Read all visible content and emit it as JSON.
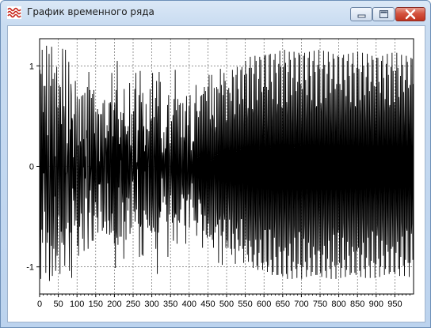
{
  "window": {
    "title": "График временного ряда",
    "icon": "wave-chart-icon",
    "controls": [
      "minimize-icon",
      "maximize-icon",
      "close-icon"
    ],
    "close_color": "#c7402c"
  },
  "chart_data": {
    "type": "line",
    "title": "",
    "xlabel": "",
    "ylabel": "",
    "xlim": [
      0,
      1000
    ],
    "ylim": [
      -1.27,
      1.27
    ],
    "x_ticks": [
      0,
      50,
      100,
      150,
      200,
      250,
      300,
      350,
      400,
      450,
      500,
      550,
      600,
      650,
      700,
      750,
      800,
      850,
      900,
      950
    ],
    "y_ticks": [
      1,
      0,
      -1
    ],
    "grid": true,
    "grid_style": "dashed",
    "line_color": "#000000",
    "series": [
      {
        "values": [
          0.17,
          0.96,
          -0.58,
          -1.12,
          0.92,
          0.05,
          -0.63,
          1.16,
          -0.76,
          -0.18,
          0.54,
          -0.07,
          0.8,
          -0.13,
          -0.45,
          0.8,
          0.43,
          -1.06,
          -0.13,
          1.2,
          -0.1,
          -0.76,
          0.31,
          -0.66,
          -0.42,
          0.44,
          1.12,
          -1.14,
          -0.92,
          -0.09,
          0.8,
          -0.15,
          -0.79,
          1.19,
          0.32,
          -1.09,
          -0.2,
          0.87,
          -0.5,
          -0.82,
          0.39,
          0.93,
          -0.3,
          0.1,
          -1.04,
          -0.82,
          0.65,
          0.99,
          -0.89,
          -0.62,
          0.59,
          0.41,
          -0.49,
          -0.13,
          0.81,
          0.12,
          -1.07,
          0.79,
          0.49,
          -0.65,
          0.42,
          -0.76,
          -0.49,
          1.17,
          0.67,
          -0.62,
          -0.78,
          0.6,
          0.46,
          -0.99,
          -0.57,
          1.16,
          0.11,
          -0.62,
          -0.08,
          -0.05,
          0.23,
          0.05,
          -0.56,
          0.4,
          1.04,
          -0.67,
          -1.04,
          0.12,
          0.37,
          -0.66,
          0.82,
          0.71,
          -1.11,
          0.48,
          0.45,
          -0.22,
          0.09,
          -0.34,
          -0.18,
          0.52,
          -0.59,
          -0.33,
          0.85,
          -0.23,
          -0.54,
          0.14,
          0.41,
          0.69,
          -0.79,
          -0.41,
          0.21,
          -0.89,
          0.49,
          0.67,
          -0.6,
          -0.31,
          0.25,
          0.14,
          -0.47,
          0.7,
          0.18,
          -0.37,
          -0.72,
          0.71,
          -0.01,
          0.27,
          -0.84,
          -0.07,
          0.73,
          -0.12,
          0.1,
          -0.3,
          -0.32,
          0.36,
          0.28,
          0.79,
          -0.46,
          -0.82,
          -0.28,
          0.94,
          -0.18,
          -0.46,
          0.76,
          -0.24,
          -0.11,
          0.01,
          0.68,
          -0.35,
          -0.74,
          0.72,
          0.3,
          -0.74,
          0.07,
          0.76,
          -0.49,
          0.33,
          0.02,
          -0.36,
          0.54,
          0.09,
          -0.34,
          -0.51,
          0.37,
          0.57,
          -0.66,
          -0.17,
          0.52,
          -0.18,
          0.05,
          -0.18,
          -0.14,
          0.52,
          -0.45,
          -0.09,
          0.52,
          0.07,
          -0.64,
          0.14,
          0.63,
          -0.61,
          -0.24,
          0.2,
          0.66,
          -0.36,
          -0.55,
          0.28,
          0.28,
          0.1,
          -0.67,
          0.41,
          0.07,
          -0.17,
          0.35,
          -0.54,
          0.14,
          0.63,
          -0.68,
          -0.49,
          0.64,
          0.6,
          -0.66,
          -0.49,
          0.93,
          -0.47,
          -0.09,
          0.3,
          -0.64,
          0.21,
          0.56,
          -0.77,
          0.63,
          0.25,
          -1.01,
          0.39,
          0.76,
          -0.65,
          -0.71,
          1.05,
          0.11,
          -0.78,
          0.47,
          -0.21,
          0.22,
          0.22,
          -0.7,
          0.29,
          0.06,
          0.54,
          -0.7,
          -0.03,
          0.46,
          -0.26,
          -0.36,
          0.53,
          0.13,
          -0.92,
          0.77,
          0.11,
          -0.55,
          0.4,
          0.18,
          -0.73,
          0.32,
          -0.31,
          0.18,
          0.35,
          -0.44,
          0.4,
          -0.01,
          -0.32,
          -0.11,
          0.83,
          -0.67,
          0.05,
          0.21,
          0.1,
          -0.61,
          0.52,
          0.12,
          -0.15,
          -0.14,
          -0.02,
          0.55,
          -0.45,
          -0.2,
          0.77,
          -0.55,
          -0.35,
          0.93,
          -0.13,
          -0.43,
          0.04,
          -0.03,
          0.07,
          0.36,
          -0.57,
          0.2,
          0.71,
          -0.9,
          -0.06,
          0.95,
          -0.6,
          -0.57,
          0.64,
          0.46,
          -0.88,
          0.06,
          0.73,
          -0.89,
          0.33,
          0.4,
          -0.44,
          0.15,
          -0.05,
          0.21,
          -0.48,
          0.62,
          -0.21,
          -0.53,
          0.37,
          0.36,
          -0.61,
          0.03,
          0.2,
          0.35,
          -0.59,
          -0.33,
          0.77,
          0.0,
          -0.64,
          0.44,
          0.47,
          -0.66,
          -0.39,
          0.93,
          -0.27,
          -0.61,
          0.15,
          0.49,
          0.05,
          -0.65,
          0.24,
          0.68,
          -0.82,
          -0.31,
          0.85,
          0.24,
          -1.07,
          0.42,
          0.6,
          -0.66,
          -0.38,
          0.94,
          -0.4,
          -0.51,
          0.84,
          -0.45,
          -0.08,
          0.28,
          -0.03,
          -0.12,
          0.14,
          0.1,
          -0.36,
          0.07,
          0.34,
          -0.3,
          -0.07,
          0.12,
          0.18,
          -0.38,
          0.18,
          0.39,
          -0.55,
          0.08,
          0.61,
          -0.9,
          0.04,
          0.71,
          -0.23,
          -0.48,
          0.11,
          0.23,
          0.04,
          -0.29,
          -0.05,
          0.45,
          -0.12,
          -0.56,
          0.31,
          0.51,
          -0.74,
          0.05,
          0.67,
          -0.43,
          -0.51,
          0.96,
          -0.46,
          -0.48,
          0.56,
          0.31,
          -0.77,
          -0.06,
          0.67,
          -0.13,
          -0.54,
          0.16,
          0.61,
          -0.56,
          -0.19,
          0.63,
          -0.43,
          -0.1,
          0.29,
          0.0,
          -0.28,
          -0.17,
          0.63,
          -0.32,
          -0.28,
          0.29,
          0.24,
          -0.59,
          0.26,
          0.55,
          -0.77,
          0.02,
          0.7,
          -0.34,
          -0.32,
          0.05,
          0.41,
          -0.28,
          -0.13,
          0.6,
          -0.61,
          -0.26,
          0.71,
          -0.11,
          -0.33,
          0.16,
          0.03,
          -0.17,
          0.05,
          0.25,
          -0.41,
          0.22,
          0.25,
          -0.54,
          0.08,
          0.63,
          -0.39,
          -0.54,
          0.81,
          -0.06,
          -0.69,
          0.55,
          0.24,
          -0.56,
          0.02,
          0.49,
          -0.33,
          -0.22,
          0.55,
          -0.32,
          -0.37,
          0.7,
          -0.29,
          -0.48,
          0.71,
          0.14,
          -0.81,
          0.17,
          0.72,
          -0.64,
          -0.28,
          0.79,
          -0.37,
          -0.49,
          0.75,
          -0.09,
          -0.68,
          0.65,
          0.2,
          -0.71,
          0.06,
          0.79,
          -0.57,
          -0.44,
          0.91,
          -0.11,
          -0.7,
          0.47,
          0.37,
          -0.68,
          -0.23,
          0.91,
          -0.2,
          -0.73,
          0.51,
          0.46,
          -0.81,
          -0.18,
          0.78,
          -0.04,
          -0.66,
          0.33,
          0.39,
          -0.6,
          -0.05,
          0.79,
          -0.42,
          -0.58,
          0.77,
          0.24,
          -0.96,
          0.2,
          0.73,
          -0.53,
          -0.49,
          0.97,
          -0.27,
          -0.69,
          0.81,
          0.22,
          -0.98,
          0.29,
          0.71,
          -0.65,
          -0.29,
          0.93,
          -0.46,
          -0.53,
          0.85,
          0.03,
          -0.81,
          0.43,
          0.46,
          -0.74,
          0.03,
          0.76,
          -0.81,
          -0.14,
          0.78,
          -0.31,
          -0.53,
          0.73,
          0.11,
          -0.82,
          0.34,
          0.65,
          -0.88,
          -0.06,
          0.96,
          -0.43,
          -0.67,
          0.89,
          0.03,
          -0.82,
          0.46,
          0.52,
          -0.97,
          0.11,
          0.91,
          -0.62,
          -0.54,
          0.99,
          -0.21,
          -0.73,
          0.77,
          0.16,
          -0.84,
          0.31,
          0.62,
          -0.79,
          -0.14,
          0.96,
          -0.52,
          -0.52,
          0.99,
          -0.15,
          -0.82,
          0.67,
          0.42,
          -0.96,
          0.12,
          0.91,
          -0.79,
          -0.36,
          1.05,
          -0.37,
          -0.73,
          0.92,
          0.05,
          -0.88,
          0.48,
          0.58,
          -0.95,
          0.01,
          0.98,
          -0.74,
          -0.47,
          1.09,
          -0.38,
          -0.8,
          0.98,
          0.03,
          -0.95,
          0.57,
          0.53,
          -1.01,
          0.13,
          0.92,
          -0.88,
          -0.33,
          1.1,
          -0.48,
          -0.73,
          1.05,
          -0.05,
          -0.99,
          0.66,
          0.47,
          -1.03,
          0.16,
          0.87,
          -0.86,
          -0.35,
          1.09,
          -0.49,
          -0.73,
          1.06,
          -0.09,
          -0.96,
          0.74,
          0.37,
          -1.03,
          0.29,
          0.79,
          -0.96,
          -0.19,
          1.1,
          -0.63,
          -0.63,
          1.11,
          -0.22,
          -0.95,
          0.79,
          0.32,
          -1.05,
          0.34,
          0.76,
          -0.99,
          -0.18,
          1.11,
          -0.62,
          -0.63,
          1.12,
          -0.26,
          -0.93,
          0.84,
          0.25,
          -1.08,
          0.45,
          0.67,
          -1.05,
          -0.05,
          1.06,
          -0.71,
          -0.52,
          1.12,
          -0.31,
          -0.9,
          0.93,
          0.14,
          -1.08,
          0.52,
          0.62,
          -1.08,
          0.03,
          1.02,
          -0.8,
          -0.45,
          1.15,
          -0.41,
          -0.85,
          0.99,
          0.06,
          -1.07,
          0.59,
          0.55,
          -1.09,
          0.1,
          0.99,
          -0.84,
          -0.41,
          1.16,
          -0.45,
          -0.81,
          1.03,
          0.01,
          -1.07,
          0.64,
          0.51,
          -1.12,
          0.18,
          0.94,
          -0.89,
          -0.33,
          1.14,
          -0.52,
          -0.77,
          1.06,
          -0.06,
          -1.04,
          0.71,
          0.43,
          -1.12,
          0.27,
          0.88,
          -0.95,
          -0.24,
          1.14,
          -0.59,
          -0.71,
          1.08,
          -0.1,
          -1.02,
          0.75,
          0.39,
          -1.11,
          0.33,
          0.84,
          -0.97,
          -0.18,
          1.13,
          -0.65,
          -0.65,
          1.11,
          -0.17,
          -0.98,
          0.82,
          0.31,
          -1.12,
          0.41,
          0.77,
          -1.0,
          -0.09,
          1.1,
          -0.72,
          -0.58,
          1.13,
          -0.24,
          -0.95,
          0.86,
          0.25,
          -1.1,
          0.46,
          0.71,
          -1.03,
          -0.03,
          1.08,
          -0.76,
          -0.52,
          1.14,
          -0.3,
          -0.91,
          0.9,
          0.18,
          -1.09,
          0.52,
          0.66,
          -1.05,
          0.04,
          1.05,
          -0.8,
          -0.47,
          1.15,
          -0.35,
          -0.88,
          0.94,
          0.12,
          -1.08,
          0.58,
          0.6,
          -1.08,
          0.11,
          1.01,
          -0.84,
          -0.4,
          1.16,
          -0.42,
          -0.84,
          0.97,
          0.05,
          -1.06,
          0.63,
          0.54,
          -1.1,
          0.17,
          0.97,
          -0.88,
          -0.34,
          1.15,
          -0.48,
          -0.79,
          1.01,
          -0.01,
          -1.04,
          0.68,
          0.47,
          -1.11,
          0.24,
          0.92,
          -0.92,
          -0.27,
          1.14,
          -0.54,
          -0.74,
          1.04,
          -0.07,
          -1.02,
          0.73,
          0.41,
          -1.12,
          0.31,
          0.87,
          -0.95,
          -0.2,
          1.12,
          -0.6,
          -0.68,
          1.07,
          -0.13,
          -0.99,
          0.77,
          0.35,
          -1.12,
          0.37,
          0.82,
          -0.98,
          -0.14,
          1.1,
          -0.66,
          -0.62,
          1.09,
          -0.2,
          -0.96,
          0.82,
          0.28,
          -1.11,
          0.43,
          0.76,
          -1.01,
          -0.07,
          1.08,
          -0.71,
          -0.56,
          1.11,
          -0.26,
          -0.93,
          0.86,
          0.22,
          -1.1,
          0.49,
          0.7,
          -1.03,
          0.0,
          1.05,
          -0.75,
          -0.5,
          1.12,
          -0.32,
          -0.89,
          0.9,
          0.15,
          -1.08,
          0.55,
          0.64,
          -1.06,
          0.07,
          1.02,
          -0.8,
          -0.43,
          1.13,
          -0.38,
          -0.85,
          0.93,
          0.09,
          -1.06,
          0.6,
          0.58,
          -1.08,
          0.14,
          0.98,
          -0.84,
          -0.37,
          1.14,
          -0.45,
          -0.81,
          0.97,
          0.02,
          -1.04,
          0.66,
          0.51,
          -1.1,
          0.21,
          0.94,
          -0.88,
          -0.3,
          1.13,
          -0.51,
          -0.76,
          1.0,
          -0.04,
          -1.02,
          0.71,
          0.45,
          -1.11,
          0.28,
          0.89,
          -0.91,
          -0.23,
          1.12,
          -0.57,
          -0.71,
          1.03,
          -0.11,
          -0.99,
          0.75,
          0.38,
          -1.11,
          0.34,
          0.84,
          -0.94,
          -0.16,
          1.1,
          -0.63,
          -0.65,
          1.06,
          -0.17,
          -0.96,
          0.8,
          0.32,
          -1.11,
          0.41,
          0.79,
          -0.97,
          -0.09,
          1.08,
          -0.69,
          -0.58,
          1.08,
          -0.24,
          -0.92,
          0.84,
          0.25,
          -1.1,
          0.47,
          0.73,
          -1.0,
          -0.02,
          1.05,
          -0.74,
          -0.52,
          1.1,
          -0.3,
          -0.89,
          0.88,
          0.18,
          -1.08,
          0.53,
          0.67,
          -1.02,
          0.05,
          1.02,
          -0.78,
          -0.45,
          1.12,
          -0.36,
          -0.85,
          0.91,
          0.12,
          -1.07,
          0.58,
          0.61,
          -1.05,
          0.12,
          0.99,
          -0.82,
          -0.38,
          1.13,
          -0.43,
          -0.8,
          0.95,
          0.05,
          -1.05,
          0.64,
          0.54,
          -1.07,
          0.19,
          0.95,
          -0.86,
          -0.31,
          1.13,
          -0.49,
          -0.75,
          0.98,
          -0.02,
          -1.02,
          0.69,
          0.48,
          -1.09,
          0.26,
          0.9,
          -0.9,
          -0.24,
          1.11,
          -0.55,
          -0.7,
          1.01,
          -0.09,
          -0.99,
          0.74,
          0.41,
          -1.09,
          0.33,
          0.86,
          -0.93,
          -0.17,
          1.1,
          -0.61,
          -0.64,
          1.04,
          -0.16,
          -0.96,
          0.78,
          0.34,
          -1.1,
          0.4,
          0.81,
          -0.96,
          -0.1,
          1.08,
          -0.67,
          -0.57,
          1.07,
          -0.22,
          -0.93,
          0.82
        ]
      }
    ]
  }
}
